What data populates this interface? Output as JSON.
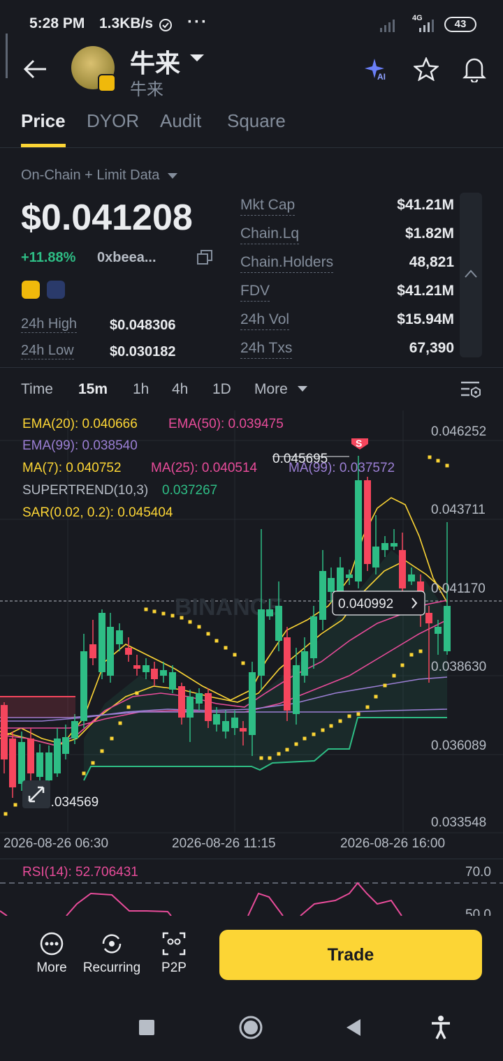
{
  "status_bar": {
    "time": "5:28 PM",
    "rate": "1.3KB/s",
    "more": "···",
    "network": "4G",
    "battery": "43"
  },
  "token": {
    "name": "牛来",
    "subname": "牛来"
  },
  "tabs": [
    "Price",
    "DYOR",
    "Audit",
    "Square"
  ],
  "data_source": "On-Chain + Limit Data",
  "price": "$0.041208",
  "change": "+11.88%",
  "address": "0xbeea...",
  "high_label": "24h High",
  "high_value": "$0.048306",
  "low_label": "24h Low",
  "low_value": "$0.030182",
  "stats": [
    {
      "label": "Mkt Cap",
      "value": "$41.21M"
    },
    {
      "label": "Chain.Lq",
      "value": "$1.82M"
    },
    {
      "label": "Chain.Holders",
      "value": "48,821"
    },
    {
      "label": "FDV",
      "value": "$41.21M"
    },
    {
      "label": "24h Vol",
      "value": "$15.94M"
    },
    {
      "label": "24h Txs",
      "value": "67,390"
    }
  ],
  "intervals": [
    "Time",
    "15m",
    "1h",
    "4h",
    "1D",
    "More"
  ],
  "indicators": {
    "ema20": "EMA(20): 0.040666",
    "ema50": "EMA(50): 0.039475",
    "ema99": "EMA(99): 0.038540",
    "ma7": "MA(7): 0.040752",
    "ma25": "MA(25): 0.040514",
    "ma99": "MA(99): 0.037572",
    "supertrend_label": "SUPERTREND(10,3)",
    "supertrend_value": "0.037267",
    "sar": "SAR(0.02, 0.2): 0.045404"
  },
  "price_axis": [
    "0.046252",
    "0.043711",
    "0.041170",
    "0.038630",
    "0.036089",
    "0.033548"
  ],
  "time_axis": [
    "2026-08-26 06:30",
    "2026-08-26 11:15",
    "2026-08-26 16:00"
  ],
  "chart_labels": {
    "high_marker": "0.045695",
    "low_marker": "0.034569",
    "current": "0.040992",
    "sell_marker": "S",
    "watermark": "BINANCE"
  },
  "rsi": {
    "label": "RSI(14): 52.706431",
    "level_70": "70.0",
    "level_50": "50.0"
  },
  "bottom": {
    "more": "More",
    "recurring": "Recurring",
    "p2p": "P2P",
    "trade": "Trade"
  },
  "colors": {
    "up": "#2ebd85",
    "down": "#f6465d",
    "accent": "#fcd535",
    "bg": "#181a20"
  }
}
